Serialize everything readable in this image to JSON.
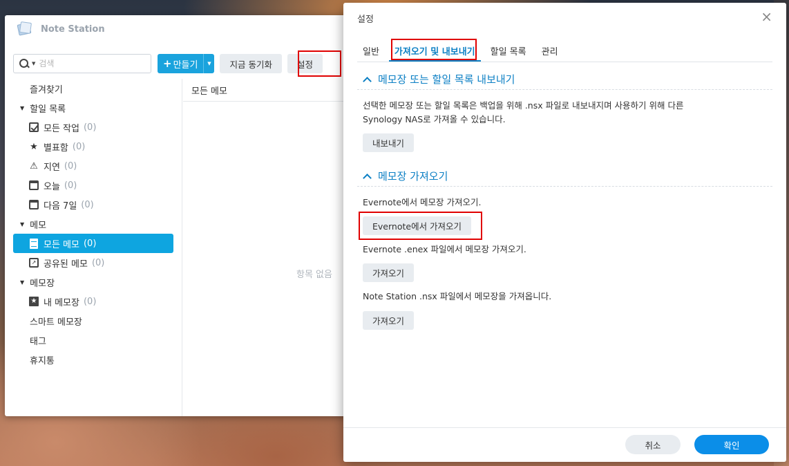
{
  "app": {
    "title": "Note Station",
    "search_placeholder": "검색",
    "toolbar": {
      "create_label": "만들기",
      "sync_label": "지금 동기화",
      "settings_label": "설정"
    },
    "sidebar": {
      "favorites": "즐겨찾기",
      "todo_group": "할일 목록",
      "todo_items": [
        {
          "label": "모든 작업",
          "count": "(0)"
        },
        {
          "label": "별표함",
          "count": "(0)"
        },
        {
          "label": "지연",
          "count": "(0)"
        },
        {
          "label": "오늘",
          "count": "(0)"
        },
        {
          "label": "다음 7일",
          "count": "(0)"
        }
      ],
      "memo_group": "메모",
      "memo_items": [
        {
          "label": "모든 메모",
          "count": "(0)"
        },
        {
          "label": "공유된 메모",
          "count": "(0)"
        }
      ],
      "notebook_group": "메모장",
      "notebook_items": [
        {
          "label": "내 메모장",
          "count": "(0)"
        }
      ],
      "smart_notebook": "스마트 메모장",
      "tags": "태그",
      "trash": "휴지통"
    },
    "list": {
      "header": "모든 메모",
      "empty": "항목 없음"
    }
  },
  "dialog": {
    "title": "설정",
    "close": "×",
    "tabs": [
      "일반",
      "가져오기 및 내보내기",
      "할일 목록",
      "관리"
    ],
    "export_section": {
      "title": "메모장 또는 할일 목록 내보내기",
      "desc_line1": "선택한 메모장 또는 할일 목록은 백업을 위해 .nsx 파일로 내보내지며 사용하기 위해 다른",
      "desc_line2": "Synology NAS로 가져올 수 있습니다.",
      "button": "내보내기"
    },
    "import_section": {
      "title": "메모장 가져오기",
      "evernote_desc": "Evernote에서 메모장 가져오기.",
      "evernote_button": "Evernote에서 가져오기",
      "enex_desc": "Evernote .enex 파일에서 메모장 가져오기.",
      "enex_button": "가져오기",
      "nsx_desc": "Note Station .nsx 파일에서 메모장을 가져옵니다.",
      "nsx_button": "가져오기"
    },
    "footer": {
      "cancel": "취소",
      "ok": "확인"
    }
  },
  "colors": {
    "accent": "#0b7fc4",
    "primary_button": "#0b8ee8",
    "sidebar_active": "#0ea5e0",
    "highlight_box": "#e00000"
  }
}
